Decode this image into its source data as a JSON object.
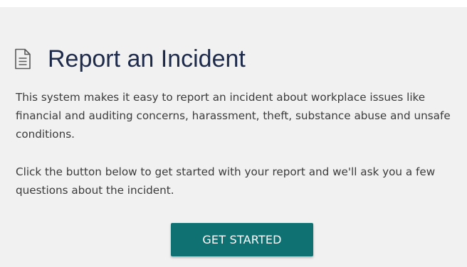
{
  "header": {
    "icon": "document-icon",
    "title": "Report an Incident"
  },
  "body": {
    "intro": "This system makes it easy to report an incident about workplace issues like financial and auditing concerns, harassment, theft, substance abuse and unsafe conditions.",
    "instructions": "Click the button below to get started with your report and we'll ask you a few questions about the incident."
  },
  "actions": {
    "get_started_label": "GET STARTED"
  },
  "colors": {
    "accent": "#0f7172",
    "title": "#1e2a4a",
    "panel_background": "#f1f1f1"
  }
}
